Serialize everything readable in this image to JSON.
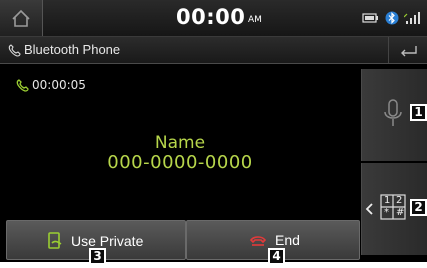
{
  "status_bar": {
    "time": "00:00",
    "ampm": "AM",
    "icons": [
      "home-icon",
      "phone-battery-icon",
      "bluetooth-icon",
      "signal-strength-icon"
    ]
  },
  "title_bar": {
    "title": "Bluetooth Phone",
    "icons": [
      "bluetooth-phone-icon",
      "back-icon"
    ]
  },
  "call": {
    "duration": "00:00:05",
    "caller_name": "Name",
    "caller_number": "000-0000-0000"
  },
  "right_panel": {
    "mute_icon": "microphone-icon",
    "keypad_digits": [
      "1",
      "2",
      "*",
      "#"
    ],
    "collapse_icon": "chevron-left-icon"
  },
  "buttons": {
    "use_private": "Use Private",
    "end": "End"
  },
  "callouts": [
    "1",
    "2",
    "3",
    "4"
  ],
  "colors": {
    "accent_green": "#b7d64b",
    "end_red": "#e23a3a",
    "background": "#000000",
    "button_gray": "#4a4a4a"
  }
}
